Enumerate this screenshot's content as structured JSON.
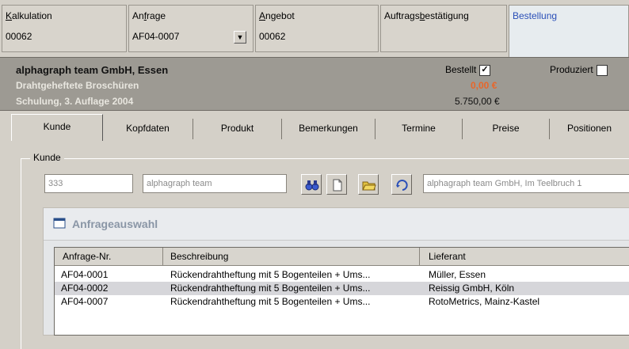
{
  "header": {
    "kalkulation": {
      "label_ul": "K",
      "label_rest": "alkulation",
      "value": "00062"
    },
    "anfrage": {
      "label_pre": "An",
      "label_ul": "f",
      "label_rest": "rage",
      "value": "AF04-0007"
    },
    "angebot": {
      "label_ul": "A",
      "label_rest": "ngebot",
      "value": "00062"
    },
    "auftrag": {
      "label_pre": "Auftrags",
      "label_ul": "b",
      "label_rest": "estätigung"
    },
    "bestellung": {
      "label": "Bestellung"
    }
  },
  "info": {
    "company": "alphagraph team GmbH, Essen",
    "line2": "Drahtgeheftete Broschüren",
    "line3": "Schulung, 3. Auflage 2004",
    "bestellt_label": "Bestellt",
    "bestellt_checked": true,
    "produziert_label": "Produziert",
    "produziert_checked": false,
    "amount_small": "0,00 €",
    "amount": "5.750,00 €"
  },
  "tabs": [
    "Kunde",
    "Kopfdaten",
    "Produkt",
    "Bemerkungen",
    "Termine",
    "Preise",
    "Positionen"
  ],
  "kunde": {
    "group_label": "Kunde",
    "nr": "333",
    "name": "alphagraph team",
    "address": "alphagraph team GmbH, Im Teelbruch 1"
  },
  "anfrageauswahl": {
    "title": "Anfrageauswahl",
    "columns": [
      "Anfrage-Nr.",
      "Beschreibung",
      "Lieferant"
    ],
    "rows": [
      {
        "nr": "AF04-0001",
        "beschreibung": "Rückendrahtheftung mit 5 Bogenteilen + Ums...",
        "lieferant": "Müller, Essen"
      },
      {
        "nr": "AF04-0002",
        "beschreibung": "Rückendrahtheftung mit 5 Bogenteilen + Ums...",
        "lieferant": "Reissig GmbH, Köln"
      },
      {
        "nr": "AF04-0007",
        "beschreibung": "Rückendrahtheftung mit 5 Bogenteilen + Ums...",
        "lieferant": "RotoMetrics, Mainz-Kastel"
      }
    ]
  },
  "colors": {
    "active_tab_text": "#2a4fb8",
    "info_bg": "#9d9a93",
    "amount_small": "#e8662a"
  },
  "icons": [
    "binoculars-icon",
    "new-document-icon",
    "open-folder-icon",
    "refresh-icon",
    "window-icon",
    "dropdown-arrow-icon"
  ]
}
